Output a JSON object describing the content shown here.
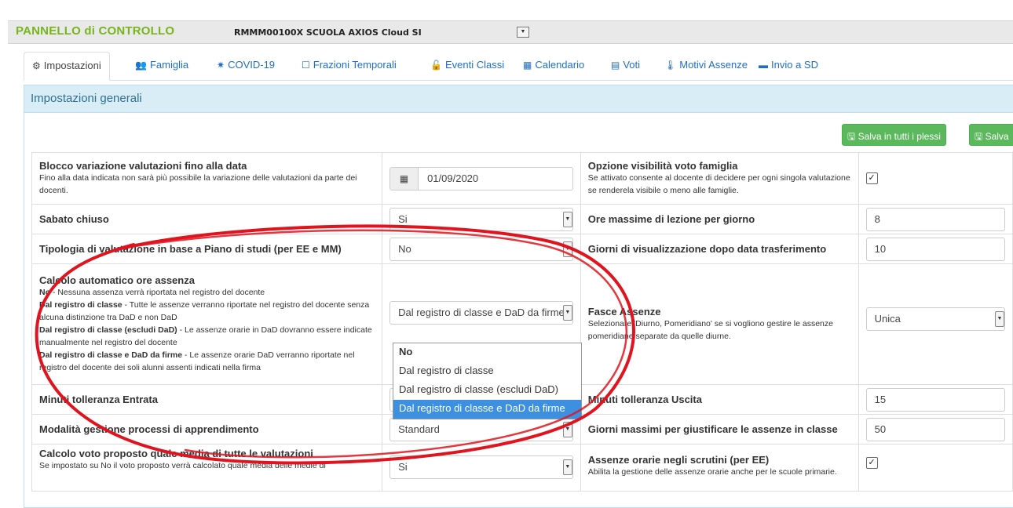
{
  "header": {
    "title": "PANNELLO di CONTROLLO",
    "school": "RMMM00100X SCUOLA AXIOS Cloud SI"
  },
  "tabs": [
    {
      "label": "Impostazioni",
      "icon": "gears-icon"
    },
    {
      "label": "Famiglia",
      "icon": "users-icon"
    },
    {
      "label": "COVID-19",
      "icon": "virus-icon"
    },
    {
      "label": "Frazioni Temporali",
      "icon": "calendar-outline-icon"
    },
    {
      "label": "Eventi Classi",
      "icon": "unlock-icon"
    },
    {
      "label": "Calendario",
      "icon": "calendar-icon"
    },
    {
      "label": "Voti",
      "icon": "calculator-icon"
    },
    {
      "label": "Motivi Assenze",
      "icon": "thermometer-icon"
    },
    {
      "label": "Invio a SD",
      "icon": "archive-icon"
    }
  ],
  "panel": {
    "title": "Impostazioni generali",
    "save_all_label": "Salva in tutti i plessi",
    "save_label": "Salva"
  },
  "rows": {
    "blocco": {
      "label": "Blocco variazione valutazioni fino alla data",
      "desc": "Fino alla data indicata non sarà più possibile la variazione delle valutazioni da parte dei docenti.",
      "value": "01/09/2020"
    },
    "opzione": {
      "label": "Opzione visibilità voto famiglia",
      "desc": "Se attivato consente al docente di decidere per ogni singola valutazione se renderela visibile o meno alle famiglie.",
      "checked": "✓"
    },
    "sabato": {
      "label": "Sabato chiuso",
      "value": "Si"
    },
    "oremax": {
      "label": "Ore massime di lezione per giorno",
      "value": "8"
    },
    "tipologia": {
      "label": "Tipologia di valutazione in base a Piano di studi (per EE e MM)",
      "value": "No"
    },
    "giorni_vis": {
      "label": "Giorni di visualizzazione dopo data trasferimento",
      "value": "10"
    },
    "calcolo": {
      "label": "Calcolo automatico ore assenza",
      "lines": [
        {
          "bold": "No",
          "text": " - Nessuna assenza verrà riportata nel registro del docente"
        },
        {
          "bold": "Dal registro di classe",
          "text": " - Tutte le assenze verranno riportate nel registro del docente senza alcuna distinzione tra DaD e non DaD"
        },
        {
          "bold": "Dal registro di classe (escludi DaD)",
          "text": " - Le assenze orarie in DaD dovranno essere indicate manualmente nel registro del docente"
        },
        {
          "bold": "Dal registro di classe e DaD da firme",
          "text": " - Le assenze orarie DaD verranno riportate nel registro del docente dei soli alunni assenti indicati nella firma"
        }
      ],
      "value": "Dal registro di classe e DaD da firme",
      "options": [
        "No",
        "Dal registro di classe",
        "Dal registro di classe (escludi DaD)",
        "Dal registro di classe e DaD da firme"
      ],
      "selected_index": 3
    },
    "fasce": {
      "label": "Fasce Assenze",
      "desc": "Selezionare 'Diurno, Pomeridiano' se si vogliono gestire le assenze pomeridiane separate da quelle diurne.",
      "value": "Unica"
    },
    "minuti_entrata": {
      "label": "Minuti tolleranza Entrata",
      "value": ""
    },
    "minuti_uscita": {
      "label": "Minuti tolleranza Uscita",
      "value": "15"
    },
    "modalita": {
      "label": "Modalità gestione processi di apprendimento",
      "value": "Standard"
    },
    "giorni_giust": {
      "label": "Giorni massimi per giustificare le assenze in classe",
      "value": "50"
    },
    "calcolo_voto": {
      "label": "Calcolo voto proposto quale media di tutte le valutazioni",
      "desc": "Se impostato su No il voto proposto verrà calcolato quale media delle medie di",
      "value": "Si"
    },
    "assenze_orarie": {
      "label": "Assenze orarie negli scrutini (per EE)",
      "desc": "Abilita la gestione delle assenze orarie anche per le scuole primarie.",
      "checked": "✓"
    }
  },
  "colors": {
    "brand": "#78b41e",
    "link": "#1f6fc5",
    "panel_head": "#d9edf7",
    "save_button": "#5cb85c",
    "annotation": "#e0141e",
    "selected_option": "#3d8fe0"
  }
}
